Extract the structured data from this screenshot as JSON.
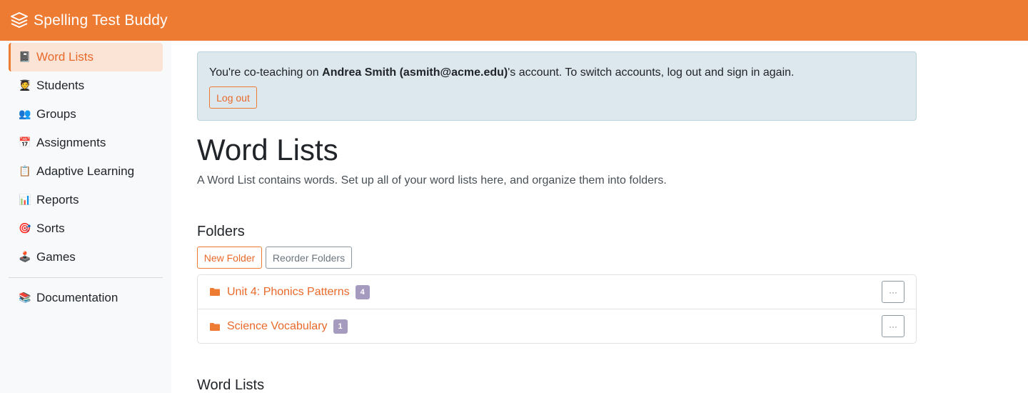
{
  "app": {
    "brand": "Spelling Test Buddy",
    "accent": "#ee7b32"
  },
  "sidebar": {
    "items": [
      {
        "label": "Word Lists",
        "icon": "📓",
        "active": true
      },
      {
        "label": "Students",
        "icon": "🧑‍🎓",
        "active": false
      },
      {
        "label": "Groups",
        "icon": "👥",
        "active": false
      },
      {
        "label": "Assignments",
        "icon": "📅",
        "active": false
      },
      {
        "label": "Adaptive Learning",
        "icon": "📋",
        "active": false
      },
      {
        "label": "Reports",
        "icon": "📊",
        "active": false
      },
      {
        "label": "Sorts",
        "icon": "🎯",
        "active": false
      },
      {
        "label": "Games",
        "icon": "🕹️",
        "active": false
      }
    ],
    "footer_items": [
      {
        "label": "Documentation",
        "icon": "📚"
      }
    ]
  },
  "alert": {
    "prefix": "You're co-teaching on ",
    "account": "Andrea Smith (asmith@acme.edu)",
    "suffix": "'s account. To switch accounts, log out and sign in again.",
    "logout_label": "Log out"
  },
  "main": {
    "title": "Word Lists",
    "description": "A Word List contains words. Set up all of your word lists here, and organize them into folders."
  },
  "folders": {
    "heading": "Folders",
    "new_folder_label": "New Folder",
    "reorder_label": "Reorder Folders",
    "items": [
      {
        "name": "Unit 4: Phonics Patterns",
        "count": "4"
      },
      {
        "name": "Science Vocabulary",
        "count": "1"
      }
    ],
    "more_label": "···"
  },
  "word_lists": {
    "heading": "Word Lists"
  }
}
